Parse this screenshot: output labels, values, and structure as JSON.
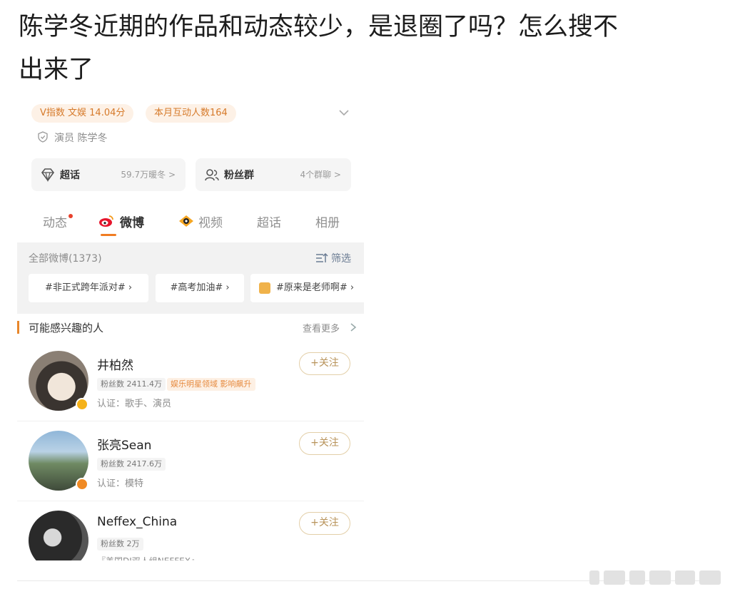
{
  "post": {
    "title_line1": "陈学冬近期的作品和动态较少，是退圈了吗？怎么搜不",
    "title_line2": "出来了"
  },
  "profile": {
    "v_index": "V指数 文娱 14.04分",
    "monthly": "本月互动人数164",
    "verified": "演员 陈学冬"
  },
  "cards": {
    "supertopic": {
      "label": "超话",
      "meta": "59.7万暖冬 >"
    },
    "fangroup": {
      "label": "粉丝群",
      "meta": "4个群聊 >"
    }
  },
  "tabs": [
    "动态",
    "微博",
    "视频",
    "超话",
    "相册"
  ],
  "feed": {
    "all_label": "全部微博(1373)",
    "filter_label": "筛选",
    "chips": [
      "#非正式跨年派对# ›",
      "#高考加油# ›",
      "#原来是老师啊# ›"
    ]
  },
  "suggest": {
    "title": "可能感兴趣的人",
    "more": "查看更多"
  },
  "people": [
    {
      "name": "井柏然",
      "fans": "粉丝数 2411.4万",
      "tag": "娱乐明星领域 影响飙升",
      "cert": "认证：歌手、演员",
      "follow": "+关注"
    },
    {
      "name": "张亮Sean",
      "fans": "粉丝数 2417.6万",
      "cert": "认证：模特",
      "follow": "+关注"
    },
    {
      "name": "Neffex_China",
      "fans": "粉丝数 2万",
      "cert": "『美国DJ双人组NEFFEX』",
      "follow": "+关注"
    }
  ],
  "colors": {
    "accent": "#f07c22",
    "tag_bg": "#fdf1e6",
    "follow_border": "#e3cfa8"
  }
}
